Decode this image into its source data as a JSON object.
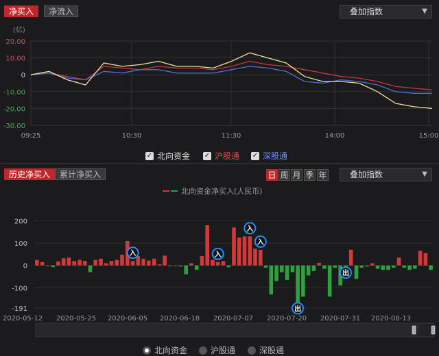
{
  "top": {
    "tabs": [
      {
        "label": "净买入",
        "active": true
      },
      {
        "label": "净流入",
        "active": false
      }
    ],
    "overlay_dropdown": "叠加指数",
    "unit": "(亿)",
    "y_ticks": [
      "20.00",
      "10.00",
      "0",
      "-10.00",
      "-20.00",
      "-30.00"
    ],
    "x_ticks": [
      "09:25",
      "10:30",
      "11:30",
      "14:00",
      "15:00"
    ],
    "legend": [
      {
        "label": "北向资金",
        "checked": true,
        "color": "#dddddd"
      },
      {
        "label": "沪股通",
        "checked": true,
        "color": "#e04848"
      },
      {
        "label": "深股通",
        "checked": true,
        "color": "#5a7fe0"
      }
    ],
    "colors": {
      "north": "#f2e0a0",
      "sh": "#c43a3a",
      "sz": "#4a6fd8",
      "pos_axis": "#e04848",
      "neg_axis": "#3cb050"
    }
  },
  "bottom": {
    "tabs": [
      {
        "label": "历史净买入",
        "active": true
      },
      {
        "label": "累计净买入",
        "active": false
      }
    ],
    "period_buttons": [
      {
        "label": "日",
        "active": true
      },
      {
        "label": "周",
        "active": false
      },
      {
        "label": "月",
        "active": false
      },
      {
        "label": "季",
        "active": false
      },
      {
        "label": "年",
        "active": false
      }
    ],
    "overlay_dropdown": "叠加指数",
    "chart_title": "北向资金净买入(人民币)",
    "y_ticks": [
      "200",
      "100",
      "0",
      "-100",
      "-191"
    ],
    "x_ticks": [
      "2020-05-12",
      "2020-05-25",
      "2020-06-05",
      "2020-06-18",
      "2020-07-07",
      "2020-07-20",
      "2020-07-31",
      "2020-08-13"
    ],
    "markers": [
      {
        "label": "入",
        "bar": 18
      },
      {
        "label": "入",
        "bar": 34
      },
      {
        "label": "入",
        "bar": 40
      },
      {
        "label": "入",
        "bar": 42
      },
      {
        "label": "出",
        "bar": 49
      },
      {
        "label": "出",
        "bar": 58
      }
    ],
    "radios": [
      {
        "label": "北向资金",
        "selected": true
      },
      {
        "label": "沪股通",
        "selected": false
      },
      {
        "label": "深股通",
        "selected": false
      }
    ],
    "colors": {
      "pos": "#d23a3a",
      "neg": "#2fa040",
      "marker": "#1e90ff"
    }
  },
  "chart_data": [
    {
      "type": "line",
      "x": [
        "09:25",
        "09:35",
        "09:45",
        "09:55",
        "10:05",
        "10:15",
        "10:25",
        "10:35",
        "10:45",
        "10:55",
        "11:05",
        "11:15",
        "11:25",
        "11:30",
        "13:05",
        "13:15",
        "13:30",
        "13:45",
        "14:00",
        "14:15",
        "14:30",
        "14:45",
        "15:00"
      ],
      "series": [
        {
          "name": "北向资金",
          "values": [
            0,
            2,
            -3,
            -6,
            7,
            5,
            6,
            8,
            5,
            5,
            4,
            8,
            13,
            10,
            7,
            -1,
            -4,
            -4,
            -5,
            -10,
            -17,
            -19,
            -20
          ]
        },
        {
          "name": "沪股通",
          "values": [
            0,
            1,
            -1,
            -3,
            5,
            4,
            3,
            5,
            4,
            4,
            3,
            5,
            8,
            6,
            5,
            3,
            1,
            -1,
            -2,
            -4,
            -7,
            -8,
            -9
          ]
        },
        {
          "name": "深股通",
          "values": [
            0,
            1,
            -2,
            -3,
            2,
            1,
            3,
            3,
            1,
            1,
            1,
            3,
            5,
            4,
            2,
            -4,
            -5,
            -3,
            -4,
            -6,
            -10,
            -11,
            -11
          ]
        }
      ],
      "ylim": [
        -30,
        20
      ],
      "ylabel": "(亿)"
    },
    {
      "type": "bar",
      "title": "北向资金净买入(人民币)",
      "values": [
        25,
        15,
        0,
        -8,
        18,
        32,
        35,
        20,
        25,
        20,
        -30,
        25,
        30,
        10,
        20,
        25,
        48,
        110,
        20,
        42,
        30,
        22,
        30,
        5,
        44,
        -2,
        0,
        -5,
        -40,
        10,
        -20,
        42,
        180,
        25,
        15,
        20,
        -8,
        170,
        125,
        130,
        130,
        75,
        70,
        -10,
        -130,
        -70,
        -30,
        -65,
        -30,
        -180,
        -140,
        -45,
        -25,
        12,
        -15,
        -140,
        -10,
        -90,
        -20,
        70,
        -60,
        -10,
        -5,
        10,
        -15,
        -20,
        -20,
        -10,
        35,
        -10,
        -20,
        -15,
        65,
        55,
        -20
      ],
      "ylim": [
        -191,
        220
      ],
      "y_ticks": [
        200,
        100,
        0,
        -100,
        -191
      ]
    }
  ]
}
